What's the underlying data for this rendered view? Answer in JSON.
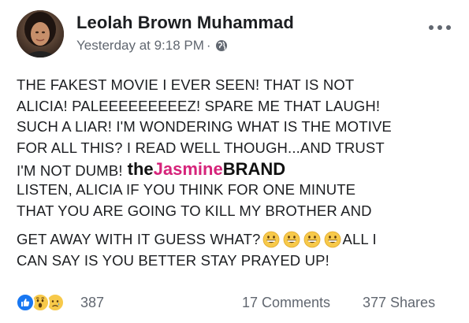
{
  "post": {
    "author": "Leolah Brown Muhammad",
    "timestamp": "Yesterday at 9:18 PM",
    "separator": "·",
    "privacy_icon": "globe-icon",
    "more_icon": "more-options-icon",
    "lines": [
      "THE FAKEST MOVIE I EVER SEEN! THAT IS NOT",
      "ALICIA! PALEEEEEEEEEZ! SPARE ME THAT LAUGH!",
      "SUCH A LIAR! I'M WONDERING WHAT IS THE MOTIVE",
      "FOR ALL THIS? I READ WELL THOUGH...AND TRUST",
      "I'M NOT DUMB!",
      "LISTEN, ALICIA IF YOU THINK FOR ONE MINUTE",
      "THAT YOU ARE GOING TO KILL MY BROTHER AND",
      "GET AWAY WITH IT GUESS WHAT?",
      "ALL I",
      "CAN SAY IS YOU BETTER STAY PRAYED UP!"
    ],
    "emoji_name": "grinning-face-icon",
    "emoji_count": 4
  },
  "watermark": {
    "part1": "the",
    "part2": "Jasmine",
    "part3": "BRAND"
  },
  "stats": {
    "reaction_icons": [
      "like-icon",
      "wow-icon",
      "sad-icon"
    ],
    "reaction_count": "387",
    "comments": "17 Comments",
    "shares": "377 Shares"
  },
  "colors": {
    "brand_pink": "#d6237a",
    "like_blue": "#1877f2",
    "reaction_yellow": "#f7c94a",
    "meta_gray": "#616770"
  }
}
